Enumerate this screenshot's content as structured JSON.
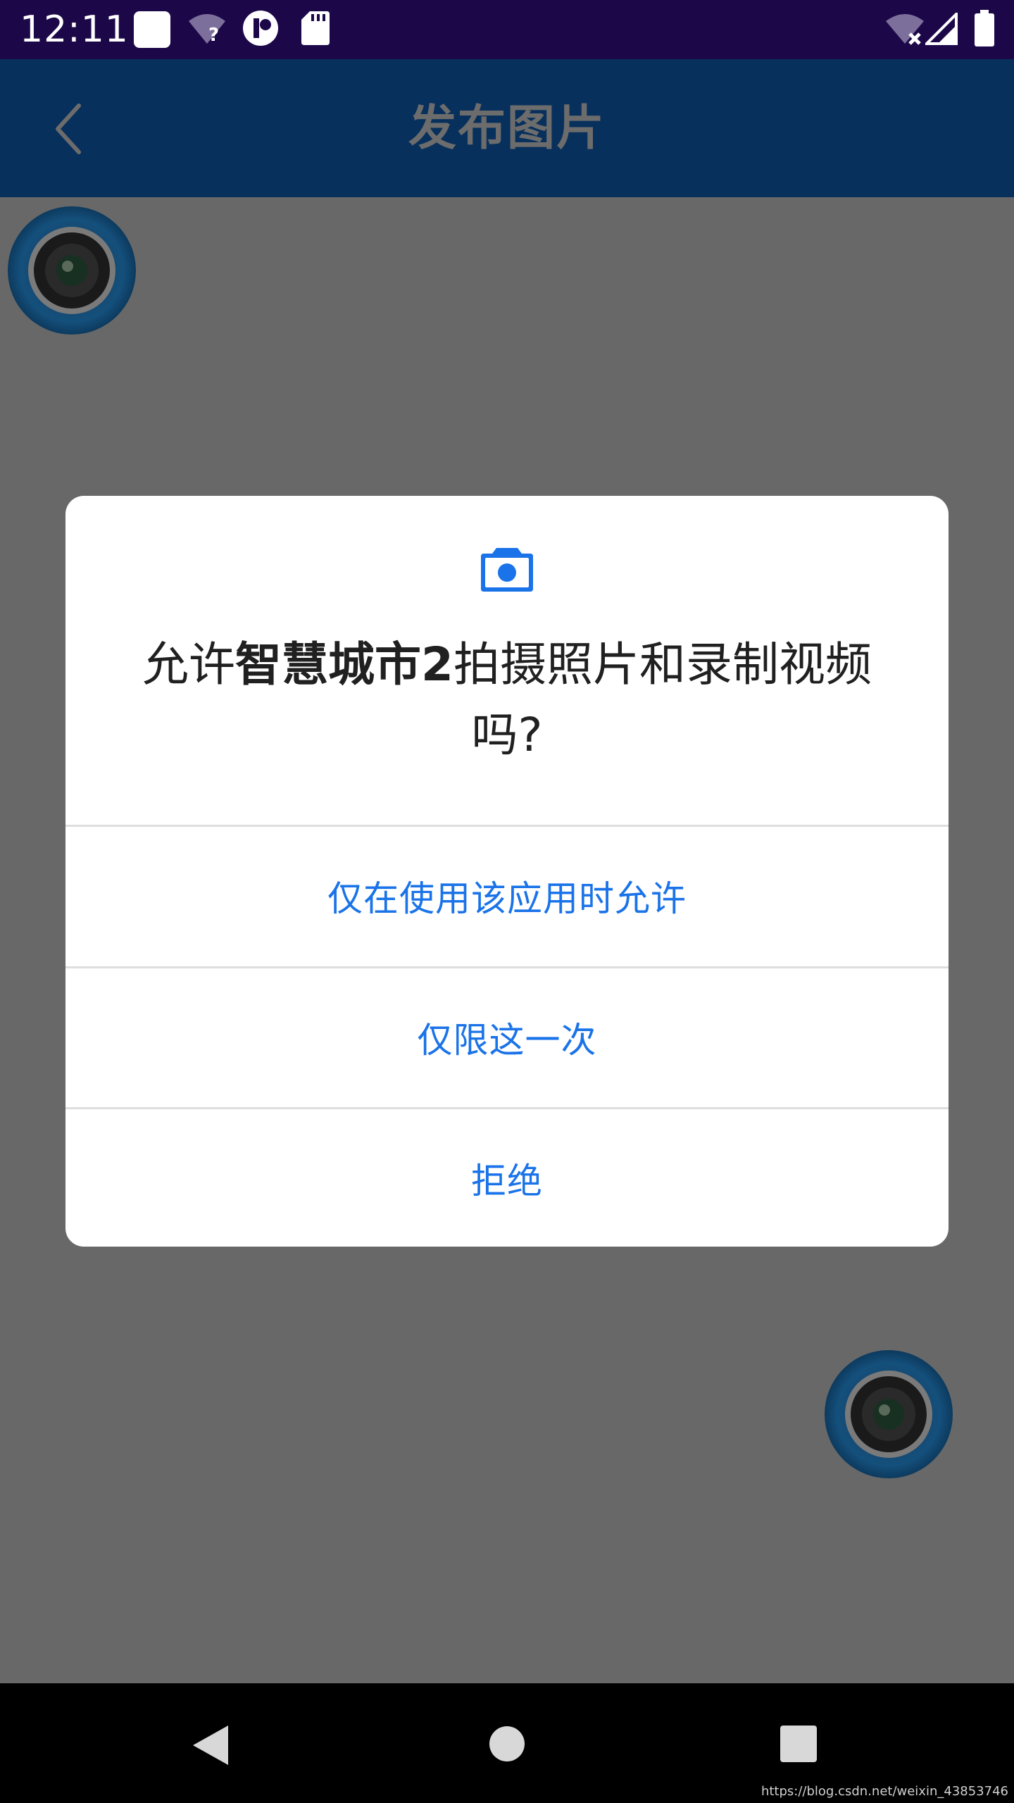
{
  "status_bar": {
    "time": "12:11",
    "icons": [
      "notification-square-icon",
      "wifi-unknown-icon",
      "app-notification-icon",
      "sd-card-icon",
      "wifi-off-icon",
      "cell-signal-icon",
      "battery-icon"
    ]
  },
  "app_bar": {
    "back_icon": "chevron-left-icon",
    "title": "发布图片"
  },
  "content": {
    "camera_buttons": [
      "camera-button-top-left",
      "camera-button-bottom-right"
    ]
  },
  "dialog": {
    "icon": "camera-icon",
    "message_prefix": "允许",
    "app_name": "智慧城市2",
    "message_suffix": "拍摄照片和录制视频吗?",
    "actions": [
      {
        "label": "仅在使用该应用时允许"
      },
      {
        "label": "仅限这一次"
      },
      {
        "label": "拒绝"
      }
    ]
  },
  "nav_bar": {
    "buttons": [
      "back-triangle-icon",
      "home-circle-icon",
      "recents-square-icon"
    ]
  },
  "watermark": "https://blog.csdn.net/weixin_43853746",
  "colors": {
    "status_bar": "#1c0848",
    "app_bar": "#08305c",
    "scrim": "#686868",
    "accent": "#1a73e8"
  }
}
